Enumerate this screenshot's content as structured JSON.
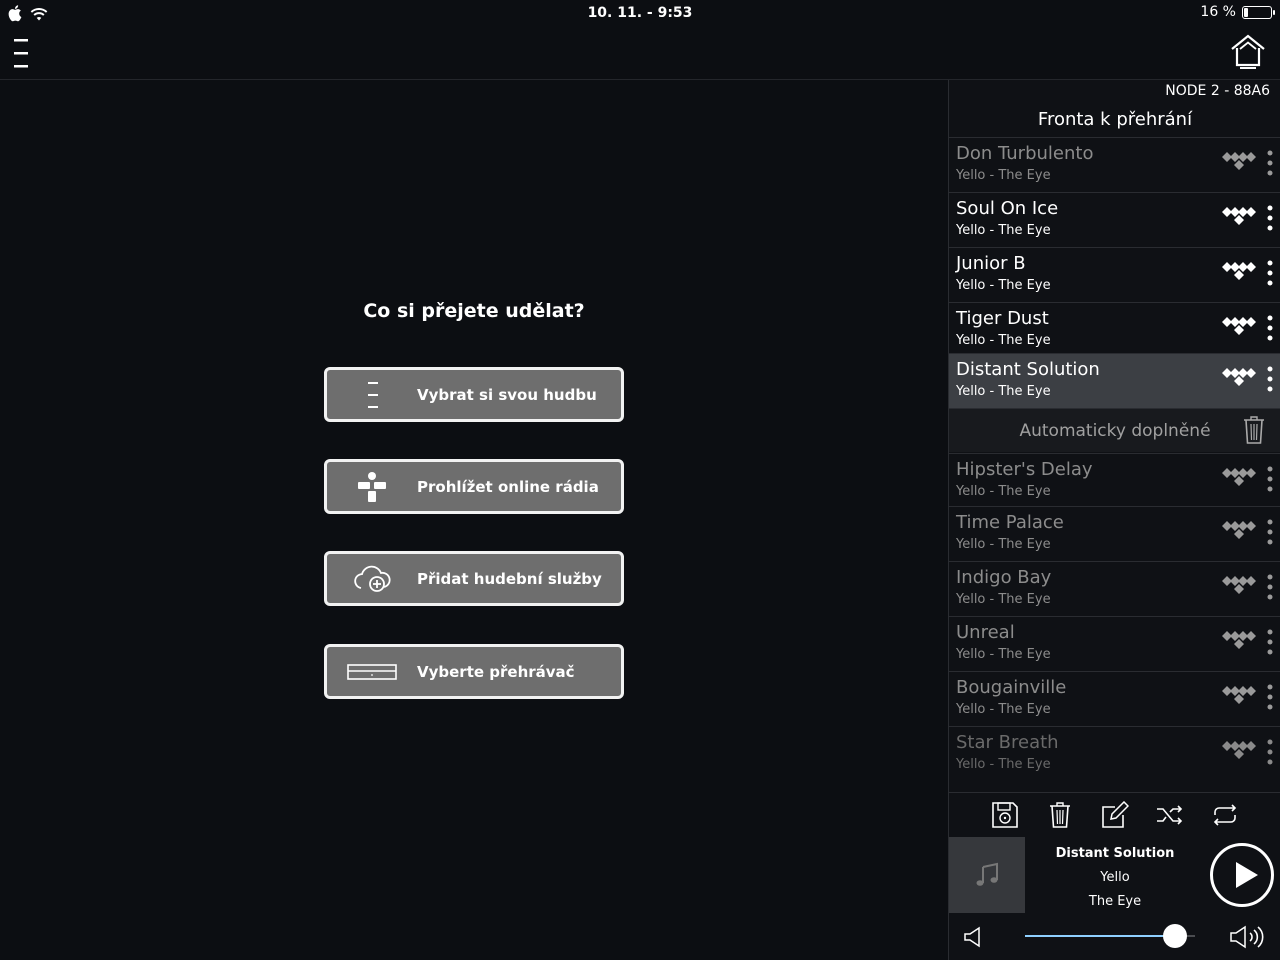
{
  "status_bar": {
    "time": "10. 11. - 9:53",
    "battery_text": "16 %",
    "battery_level": 0.16
  },
  "main": {
    "prompt": "Co si přejete udělat?",
    "actions": [
      {
        "label": "Vybrat si svou hudbu",
        "icon": "music-list-icon"
      },
      {
        "label": "Prohlížet online rádia",
        "icon": "tunein-icon"
      },
      {
        "label": "Přidat hudební služby",
        "icon": "cloud-add-icon"
      },
      {
        "label": "Vyberte přehrávač",
        "icon": "player-device-icon"
      }
    ]
  },
  "queue": {
    "node_name": "NODE 2 - 88A6",
    "title": "Fronta k přehrání",
    "played": [
      {
        "title": "Don Turbulento",
        "subtitle": "Yello - The Eye"
      },
      {
        "title": "Soul On Ice",
        "subtitle": "Yello - The Eye"
      },
      {
        "title": "Junior B",
        "subtitle": "Yello - The Eye"
      },
      {
        "title": "Tiger Dust",
        "subtitle": "Yello - The Eye"
      },
      {
        "title": "Distant Solution",
        "subtitle": "Yello - The Eye"
      }
    ],
    "auto_label": "Automaticky doplněné",
    "auto": [
      {
        "title": "Hipster's Delay",
        "subtitle": "Yello - The Eye"
      },
      {
        "title": "Time Palace",
        "subtitle": "Yello - The Eye"
      },
      {
        "title": "Indigo Bay",
        "subtitle": "Yello - The Eye"
      },
      {
        "title": "Unreal",
        "subtitle": "Yello - The Eye"
      },
      {
        "title": "Bougainville",
        "subtitle": "Yello - The Eye"
      },
      {
        "title": "Star Breath",
        "subtitle": "Yello - The Eye"
      }
    ]
  },
  "now_playing": {
    "title": "Distant Solution",
    "artist": "Yello",
    "album": "The Eye",
    "volume": 0.88
  },
  "colors": {
    "accent": "#8fd0ff",
    "button_bg": "#6e6e6e",
    "active_row": "#3c3f44"
  }
}
